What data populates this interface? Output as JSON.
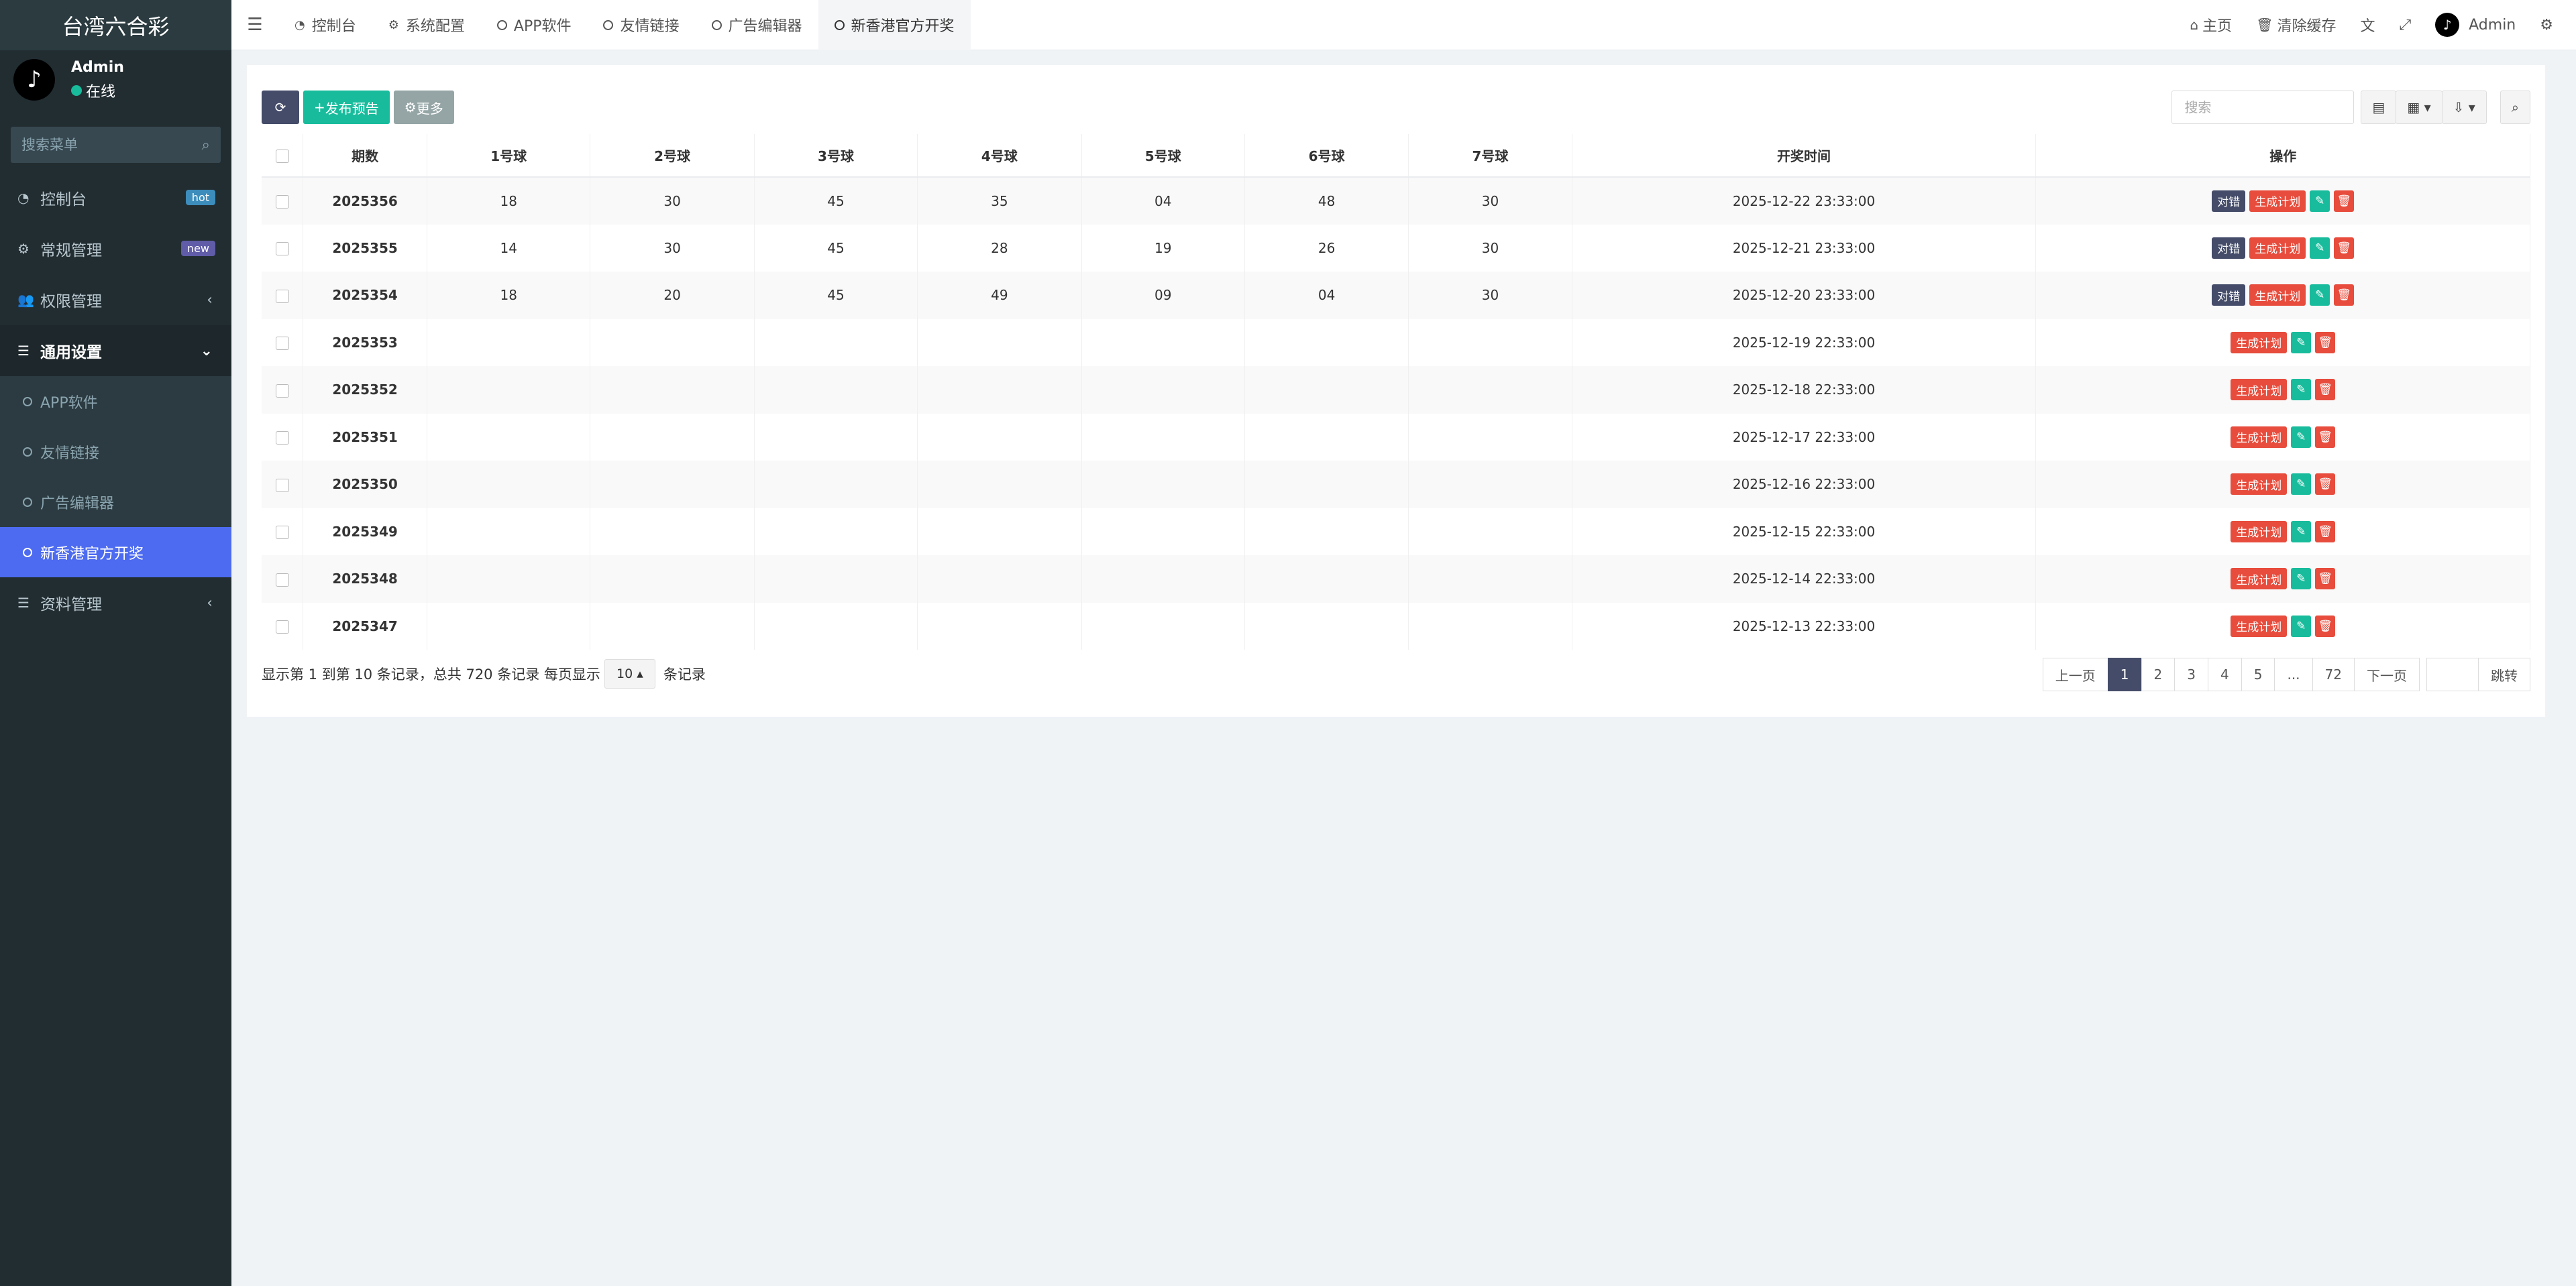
{
  "sidebar": {
    "title": "台湾六合彩",
    "user_name": "Admin",
    "user_status": "在线",
    "search_placeholder": "搜索菜单",
    "items": [
      {
        "label": "控制台",
        "badge": "hot",
        "badge_color": "#3c8dbc"
      },
      {
        "label": "常规管理",
        "badge": "new",
        "badge_color": "#605ca8"
      },
      {
        "label": "权限管理"
      },
      {
        "label": "通用设置"
      },
      {
        "label": "资料管理"
      }
    ],
    "subitems": [
      {
        "label": "APP软件"
      },
      {
        "label": "友情链接"
      },
      {
        "label": "广告编辑器"
      },
      {
        "label": "新香港官方开奖"
      }
    ]
  },
  "topbar": {
    "tabs": [
      {
        "label": "控制台"
      },
      {
        "label": "系统配置"
      },
      {
        "label": "APP软件"
      },
      {
        "label": "友情链接"
      },
      {
        "label": "广告编辑器"
      },
      {
        "label": "新香港官方开奖"
      }
    ],
    "home_label": "主页",
    "clear_cache_label": "清除缓存",
    "admin_label": "Admin"
  },
  "toolbar": {
    "publish_label": "发布预告",
    "more_label": "更多",
    "search_placeholder": "搜索"
  },
  "table": {
    "headers": [
      "期数",
      "1号球",
      "2号球",
      "3号球",
      "4号球",
      "5号球",
      "6号球",
      "7号球",
      "开奖时间",
      "操作"
    ],
    "rows": [
      {
        "period": "2025356",
        "b1": "18",
        "b2": "30",
        "b3": "45",
        "b4": "35",
        "b5": "04",
        "b6": "48",
        "b7": "30",
        "time": "2025-12-22 23:33:00",
        "has_check": true
      },
      {
        "period": "2025355",
        "b1": "14",
        "b2": "30",
        "b3": "45",
        "b4": "28",
        "b5": "19",
        "b6": "26",
        "b7": "30",
        "time": "2025-12-21 23:33:00",
        "has_check": true
      },
      {
        "period": "2025354",
        "b1": "18",
        "b2": "20",
        "b3": "45",
        "b4": "49",
        "b5": "09",
        "b6": "04",
        "b7": "30",
        "time": "2025-12-20 23:33:00",
        "has_check": true
      },
      {
        "period": "2025353",
        "b1": "",
        "b2": "",
        "b3": "",
        "b4": "",
        "b5": "",
        "b6": "",
        "b7": "",
        "time": "2025-12-19 22:33:00",
        "has_check": false
      },
      {
        "period": "2025352",
        "b1": "",
        "b2": "",
        "b3": "",
        "b4": "",
        "b5": "",
        "b6": "",
        "b7": "",
        "time": "2025-12-18 22:33:00",
        "has_check": false
      },
      {
        "period": "2025351",
        "b1": "",
        "b2": "",
        "b3": "",
        "b4": "",
        "b5": "",
        "b6": "",
        "b7": "",
        "time": "2025-12-17 22:33:00",
        "has_check": false
      },
      {
        "period": "2025350",
        "b1": "",
        "b2": "",
        "b3": "",
        "b4": "",
        "b5": "",
        "b6": "",
        "b7": "",
        "time": "2025-12-16 22:33:00",
        "has_check": false
      },
      {
        "period": "2025349",
        "b1": "",
        "b2": "",
        "b3": "",
        "b4": "",
        "b5": "",
        "b6": "",
        "b7": "",
        "time": "2025-12-15 22:33:00",
        "has_check": false
      },
      {
        "period": "2025348",
        "b1": "",
        "b2": "",
        "b3": "",
        "b4": "",
        "b5": "",
        "b6": "",
        "b7": "",
        "time": "2025-12-14 22:33:00",
        "has_check": false
      },
      {
        "period": "2025347",
        "b1": "",
        "b2": "",
        "b3": "",
        "b4": "",
        "b5": "",
        "b6": "",
        "b7": "",
        "time": "2025-12-13 22:33:00",
        "has_check": false
      }
    ],
    "op_check_label": "对错",
    "op_plan_label": "生成计划"
  },
  "footer": {
    "info_prefix": "显示第 1 到第 10 条记录，总共 720 条记录 每页显示",
    "page_size": "10",
    "info_suffix": "条记录"
  },
  "pagination": {
    "prev_label": "上一页",
    "pages": [
      "1",
      "2",
      "3",
      "4",
      "5",
      "...",
      "72"
    ],
    "active_page": "1",
    "next_label": "下一页",
    "jump_label": "跳转"
  },
  "colors": {
    "sidebar_bg": "#222d32",
    "accent_active": "#4d6bf0",
    "green": "#18bc9c",
    "red": "#e74c3c",
    "dark": "#444c69"
  }
}
